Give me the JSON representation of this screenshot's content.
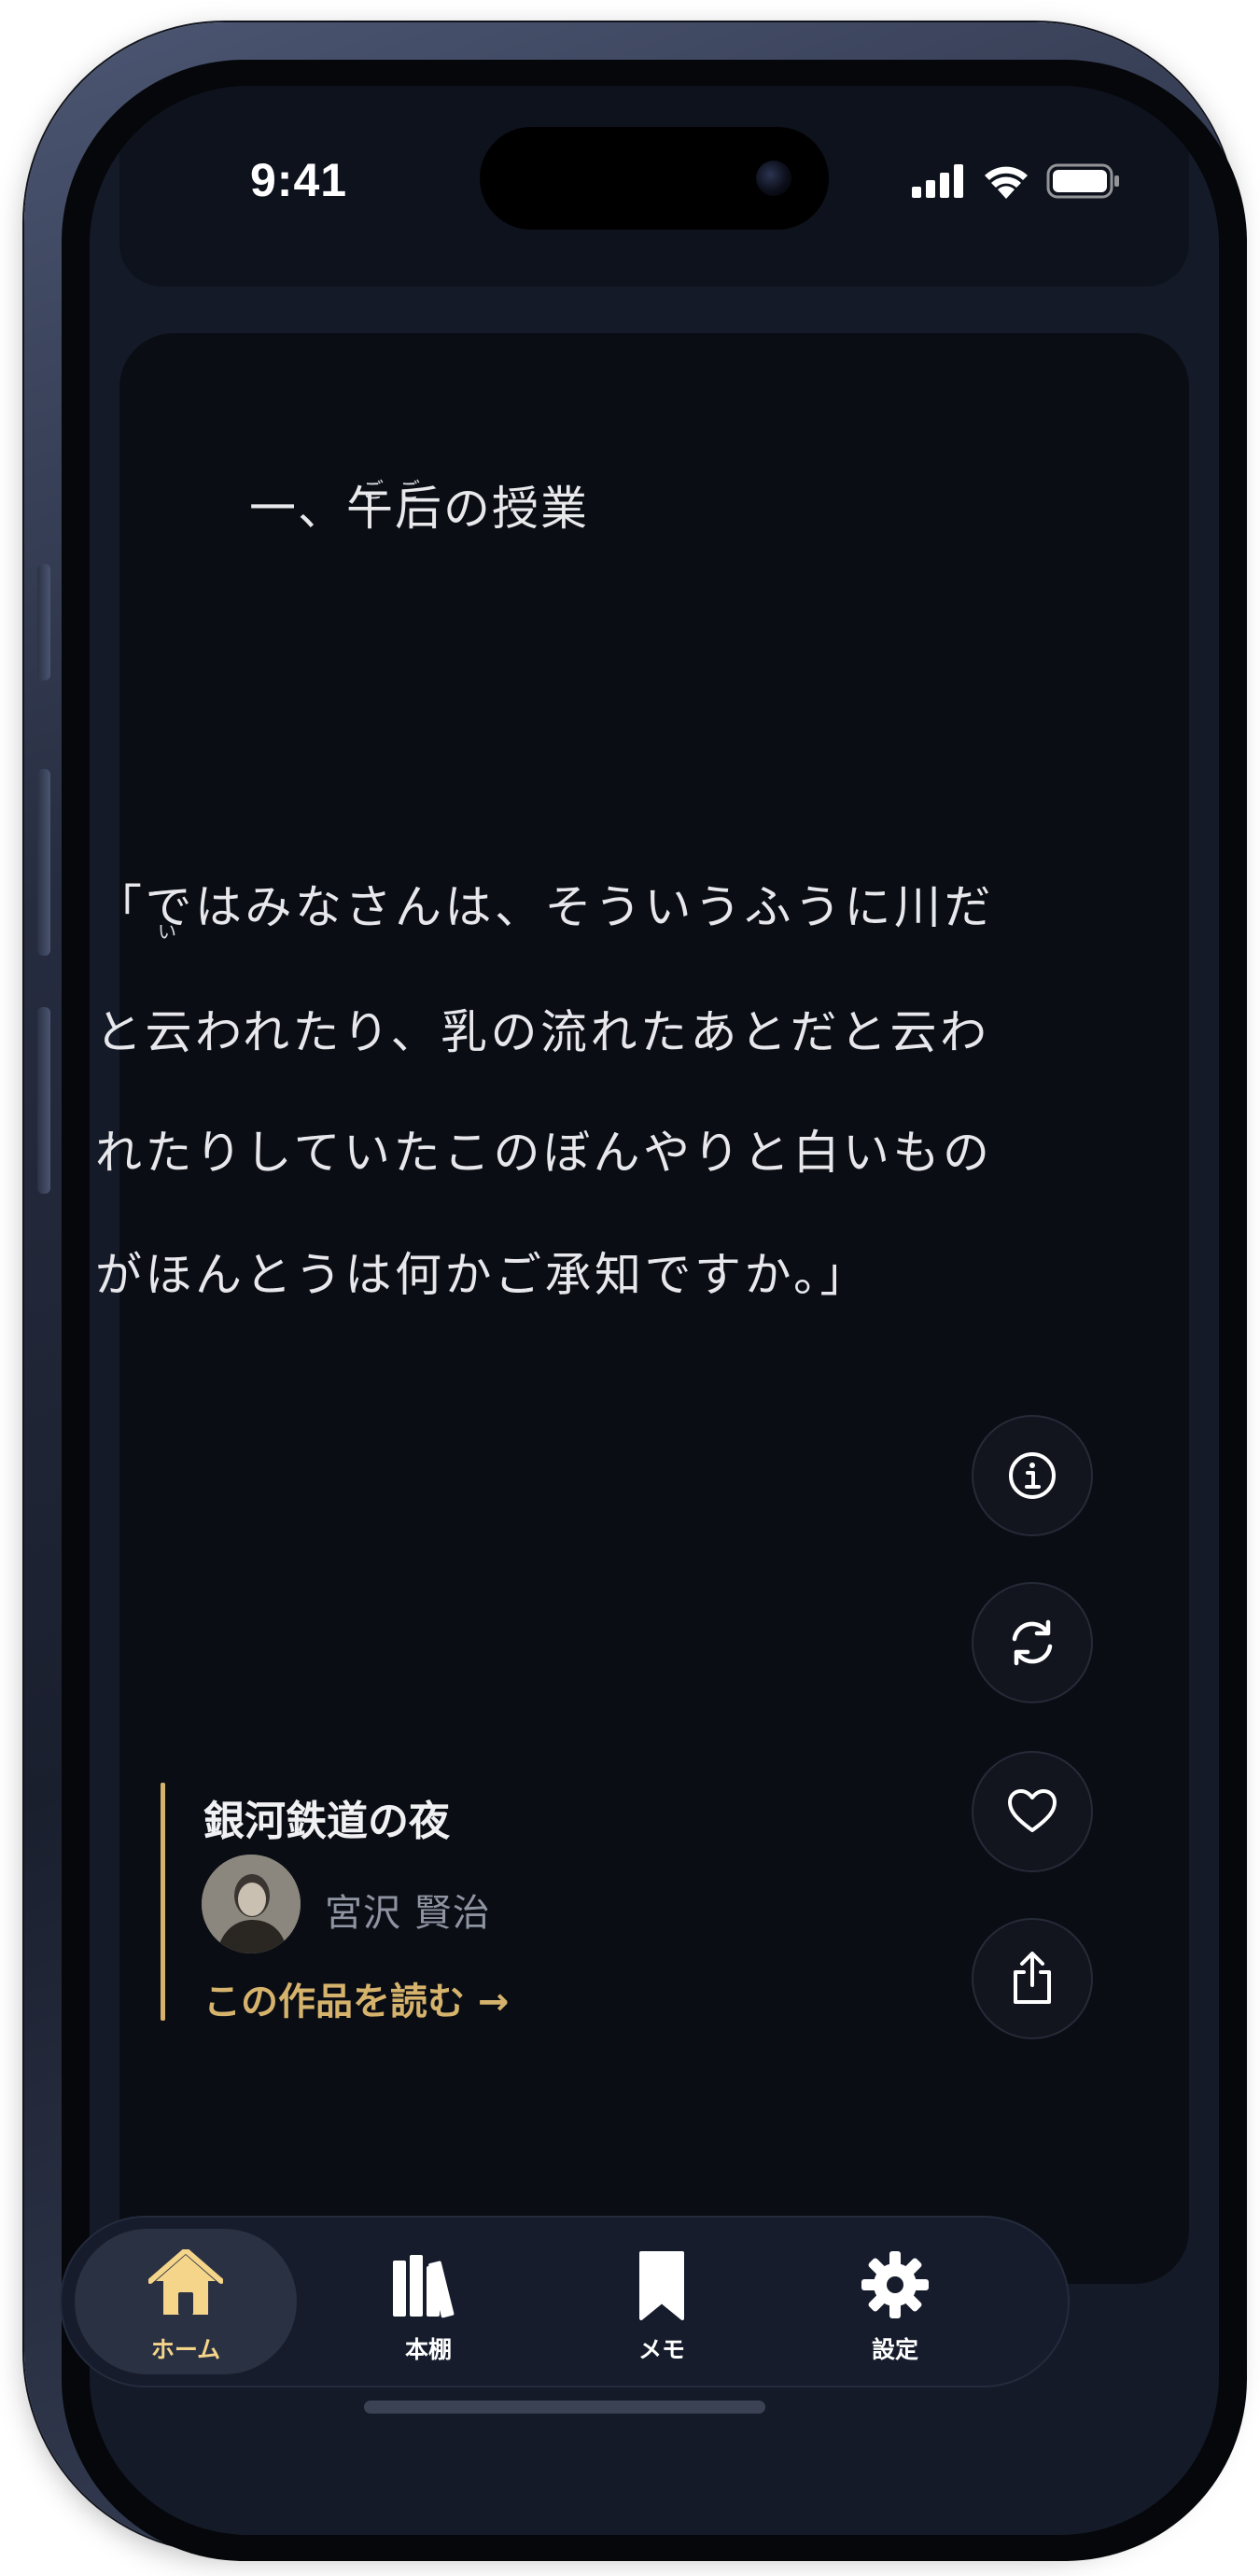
{
  "status_bar": {
    "time": "9:41",
    "icons": [
      "cellular-signal-icon",
      "wifi-icon",
      "battery-icon"
    ]
  },
  "reader": {
    "chapter_title": "一、午后の授業",
    "chapter_ruby": "ごご",
    "passage_lines": [
      "「ではみなさんは、そういうふうに川だ",
      "と云われたり、乳の流れたあとだと云わ",
      "れたりしていたこのぼんやりと白いもの",
      "がほんとうは何かご承知ですか。」"
    ],
    "passage_ruby": "い"
  },
  "actions": [
    {
      "name": "info",
      "icon": "info-icon"
    },
    {
      "name": "refresh",
      "icon": "refresh-icon"
    },
    {
      "name": "favorite",
      "icon": "heart-icon"
    },
    {
      "name": "share",
      "icon": "share-icon"
    }
  ],
  "work": {
    "title": "銀河鉄道の夜",
    "author": "宮沢 賢治",
    "read_link": "この作品を読む →"
  },
  "tab_bar": {
    "tabs": [
      {
        "label": "ホーム",
        "icon": "home-icon",
        "active": true
      },
      {
        "label": "本棚",
        "icon": "bookshelf-icon",
        "active": false
      },
      {
        "label": "メモ",
        "icon": "bookmark-icon",
        "active": false
      },
      {
        "label": "設定",
        "icon": "gear-icon",
        "active": false
      }
    ]
  },
  "colors": {
    "accent": "#d6b36c",
    "tab_active_label": "#f5d58a",
    "background": "#0a0d14",
    "text": "#e8e8ec"
  }
}
